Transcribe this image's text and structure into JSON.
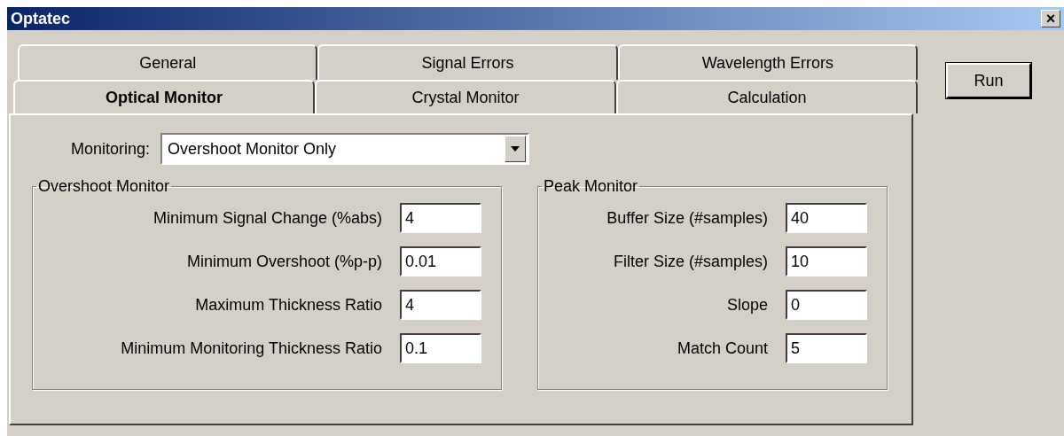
{
  "window": {
    "title": "Optatec",
    "close_label": "×"
  },
  "tab_rows": [
    {
      "tabs": [
        {
          "label": "General",
          "selected": false
        },
        {
          "label": "Signal Errors",
          "selected": false
        },
        {
          "label": "Wavelength Errors",
          "selected": false
        }
      ]
    },
    {
      "tabs": [
        {
          "label": "Optical Monitor",
          "selected": true
        },
        {
          "label": "Crystal Monitor",
          "selected": false
        },
        {
          "label": "Calculation",
          "selected": false
        }
      ]
    }
  ],
  "monitoring": {
    "label": "Monitoring:",
    "value": "Overshoot Monitor Only"
  },
  "groups": [
    {
      "title": "Overshoot Monitor",
      "fields": [
        {
          "label": "Minimum Signal Change (%abs)",
          "value": "4"
        },
        {
          "label": "Minimum Overshoot (%p-p)",
          "value": "0.01"
        },
        {
          "label": "Maximum Thickness Ratio",
          "value": "4"
        },
        {
          "label": "Minimum Monitoring Thickness Ratio",
          "value": "0.1"
        }
      ]
    },
    {
      "title": "Peak Monitor",
      "fields": [
        {
          "label": "Buffer Size (#samples)",
          "value": "40"
        },
        {
          "label": "Filter Size (#samples)",
          "value": "10"
        },
        {
          "label": "Slope",
          "value": "0"
        },
        {
          "label": "Match Count",
          "value": "5"
        }
      ]
    }
  ],
  "buttons": [
    "Run"
  ]
}
